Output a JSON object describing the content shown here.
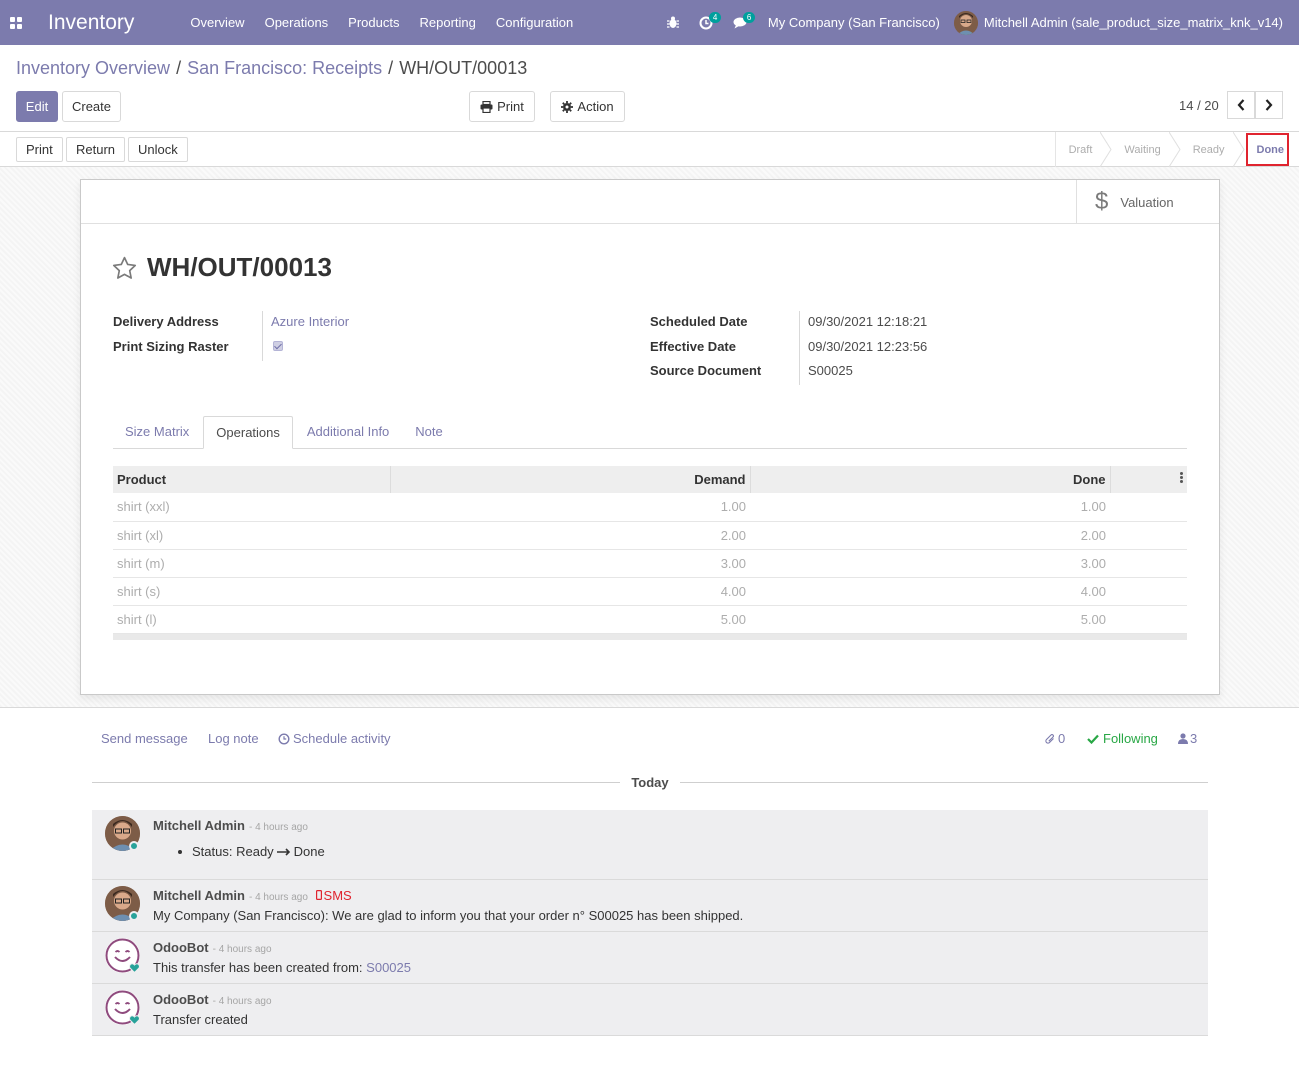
{
  "navbar": {
    "app_name": "Inventory",
    "menu": [
      "Overview",
      "Operations",
      "Products",
      "Reporting",
      "Configuration"
    ],
    "activity_count": "4",
    "message_count": "6",
    "company": "My Company (San Francisco)",
    "user": "Mitchell Admin (sale_product_size_matrix_knk_v14)"
  },
  "breadcrumb": {
    "items": [
      "Inventory Overview",
      "San Francisco: Receipts"
    ],
    "current": "WH/OUT/00013"
  },
  "buttons": {
    "edit": "Edit",
    "create": "Create",
    "print": "Print",
    "action": "Action"
  },
  "pager": {
    "value": "14 / 20"
  },
  "statusbar": {
    "buttons": [
      "Print",
      "Return",
      "Unlock"
    ],
    "stages": [
      "Draft",
      "Waiting",
      "Ready",
      "Done"
    ],
    "active_stage": "Done"
  },
  "sheet": {
    "valuation_label": "Valuation",
    "title": "WH/OUT/00013",
    "fields_left": {
      "delivery_address_label": "Delivery Address",
      "delivery_address": "Azure Interior",
      "print_sizing_raster_label": "Print Sizing Raster",
      "print_sizing_raster": true
    },
    "fields_right": {
      "scheduled_date_label": "Scheduled Date",
      "scheduled_date": "09/30/2021 12:18:21",
      "effective_date_label": "Effective Date",
      "effective_date": "09/30/2021 12:23:56",
      "source_document_label": "Source Document",
      "source_document": "S00025"
    },
    "tabs": [
      "Size Matrix",
      "Operations",
      "Additional Info",
      "Note"
    ],
    "active_tab": "Operations",
    "table": {
      "headers": [
        "Product",
        "Demand",
        "Done"
      ],
      "rows": [
        {
          "product": "shirt (xxl)",
          "demand": "1.00",
          "done": "1.00"
        },
        {
          "product": "shirt (xl)",
          "demand": "2.00",
          "done": "2.00"
        },
        {
          "product": "shirt (m)",
          "demand": "3.00",
          "done": "3.00"
        },
        {
          "product": "shirt (s)",
          "demand": "4.00",
          "done": "4.00"
        },
        {
          "product": "shirt (l)",
          "demand": "5.00",
          "done": "5.00"
        }
      ]
    }
  },
  "chatter": {
    "send_message": "Send message",
    "log_note": "Log note",
    "schedule_activity": "Schedule activity",
    "attachments_count": "0",
    "following": "Following",
    "followers_count": "3",
    "date_separator": "Today",
    "messages": [
      {
        "author": "Mitchell Admin",
        "time": "- 4 hours ago",
        "status_from": "Ready",
        "status_to": "Done",
        "status_label": "Status:"
      },
      {
        "author": "Mitchell Admin",
        "time": "- 4 hours ago",
        "sms": "SMS",
        "body": "My Company (San Francisco): We are glad to inform you that your order n° S00025 has been shipped."
      },
      {
        "author": "OdooBot",
        "time": "- 4 hours ago",
        "body": "This transfer has been created from:",
        "link": "S00025"
      },
      {
        "author": "OdooBot",
        "time": "- 4 hours ago",
        "body": "Transfer created"
      }
    ]
  },
  "colors": {
    "brand": "#7c7bad",
    "highlight_box": "#e0242f",
    "presence": "#28a29a"
  }
}
